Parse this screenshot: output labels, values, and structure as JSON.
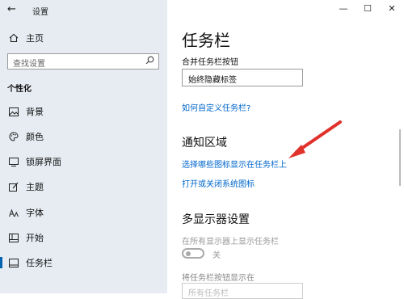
{
  "window": {
    "title": "设置",
    "controls": {
      "minimize": "—",
      "maximize": "☐",
      "close": "✕"
    }
  },
  "sidebar": {
    "home": "主页",
    "search_placeholder": "查找设置",
    "section": "个性化",
    "items": [
      {
        "label": "背景",
        "icon": "image-icon"
      },
      {
        "label": "颜色",
        "icon": "palette-icon"
      },
      {
        "label": "锁屏界面",
        "icon": "lock-screen-icon"
      },
      {
        "label": "主题",
        "icon": "brush-icon"
      },
      {
        "label": "字体",
        "icon": "font-icon"
      },
      {
        "label": "开始",
        "icon": "start-icon"
      },
      {
        "label": "任务栏",
        "icon": "taskbar-icon",
        "active": true
      }
    ]
  },
  "main": {
    "title": "任务栏",
    "combine_label": "合并任务栏按钮",
    "combine_value": "始终隐藏标签",
    "customize_link": "如何自定义任务栏?",
    "notification_heading": "通知区域",
    "select_icons_link": "选择哪些图标显示在任务栏上",
    "system_icons_link": "打开或关闭系统图标",
    "multi_display_heading": "多显示器设置",
    "show_all_displays_label": "在所有显示器上显示任务栏",
    "toggle_state": "关",
    "buttons_on_label": "将任务栏按钮显示在",
    "buttons_on_value": "所有任务栏"
  },
  "colors": {
    "accent": "#0063b1",
    "link": "#0066cc",
    "arrow": "#e0312b"
  }
}
